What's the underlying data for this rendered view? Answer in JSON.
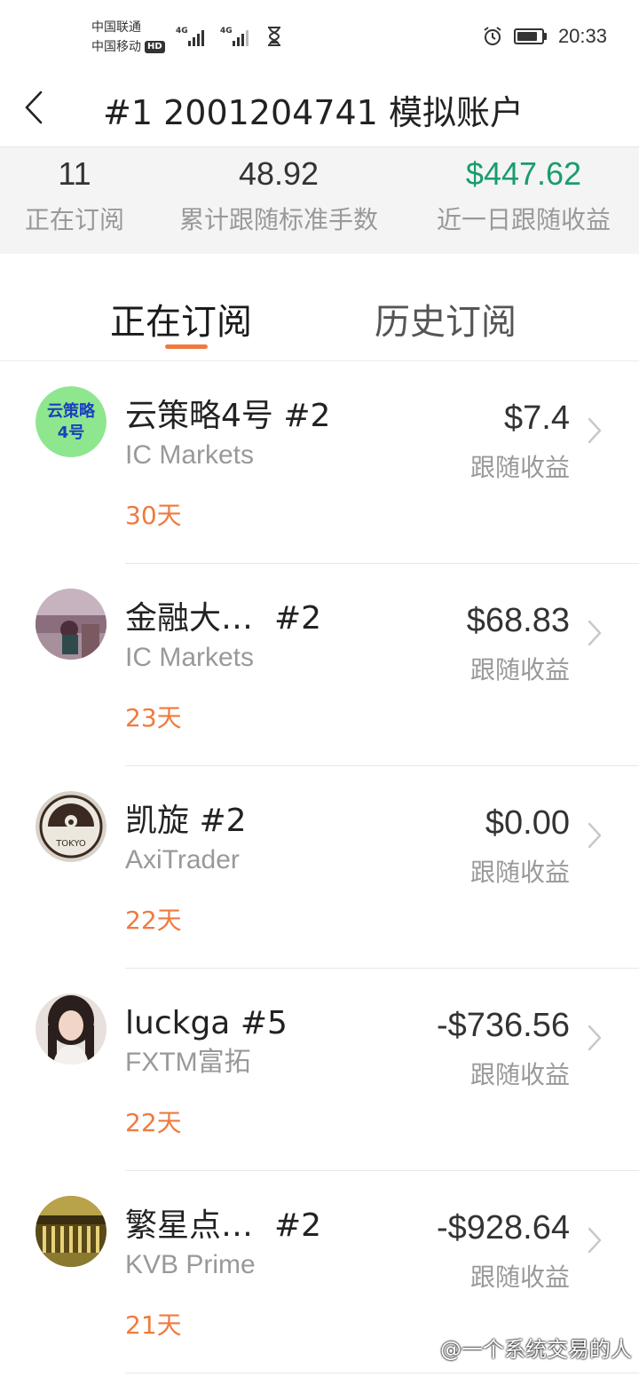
{
  "status_bar": {
    "carrier1": "中国联通",
    "carrier2": "中国移动",
    "hd": "HD",
    "network1": "4G",
    "network2": "4G",
    "time": "20:33",
    "icons": [
      "signal-icon",
      "hourglass-icon",
      "alarm-icon",
      "battery-icon"
    ]
  },
  "header": {
    "title": "#1 2001204741 模拟账户",
    "back_icon": "chevron-left-icon"
  },
  "stats": [
    {
      "value": "11",
      "label": "正在订阅"
    },
    {
      "value": "48.92",
      "label": "累计跟随标准手数"
    },
    {
      "value": "$447.62",
      "label": "近一日跟随收益"
    }
  ],
  "tabs": [
    {
      "label": "正在订阅",
      "active": true
    },
    {
      "label": "历史订阅",
      "active": false
    }
  ],
  "subscriptions": [
    {
      "name": "云策略4号 #2",
      "broker": "IC Markets",
      "days": "30天",
      "profit": "$7.4",
      "profit_label": "跟随收益",
      "positive": true,
      "avatar_text": "云策略4号"
    },
    {
      "name": "金融大…",
      "suffix": "#2",
      "broker": "IC Markets",
      "days": "23天",
      "profit": "$68.83",
      "profit_label": "跟随收益",
      "positive": true
    },
    {
      "name": "凯旋 #2",
      "broker": "AxiTrader",
      "days": "22天",
      "profit": "$0.00",
      "profit_label": "跟随收益",
      "positive": false,
      "avatar_text": "TOKYO"
    },
    {
      "name": "luckga #5",
      "broker": "FXTM富拓",
      "days": "22天",
      "profit": "-$736.56",
      "profit_label": "跟随收益",
      "positive": false
    },
    {
      "name": "繁星点…",
      "suffix": "#2",
      "broker": "KVB Prime",
      "days": "21天",
      "profit": "-$928.64",
      "profit_label": "跟随收益",
      "positive": false
    }
  ],
  "watermark": "@一个系统交易的人",
  "colors": {
    "accent_orange": "#f07a3e",
    "profit_green": "#1a9c6c",
    "stats_bg": "#f4f4f4"
  }
}
